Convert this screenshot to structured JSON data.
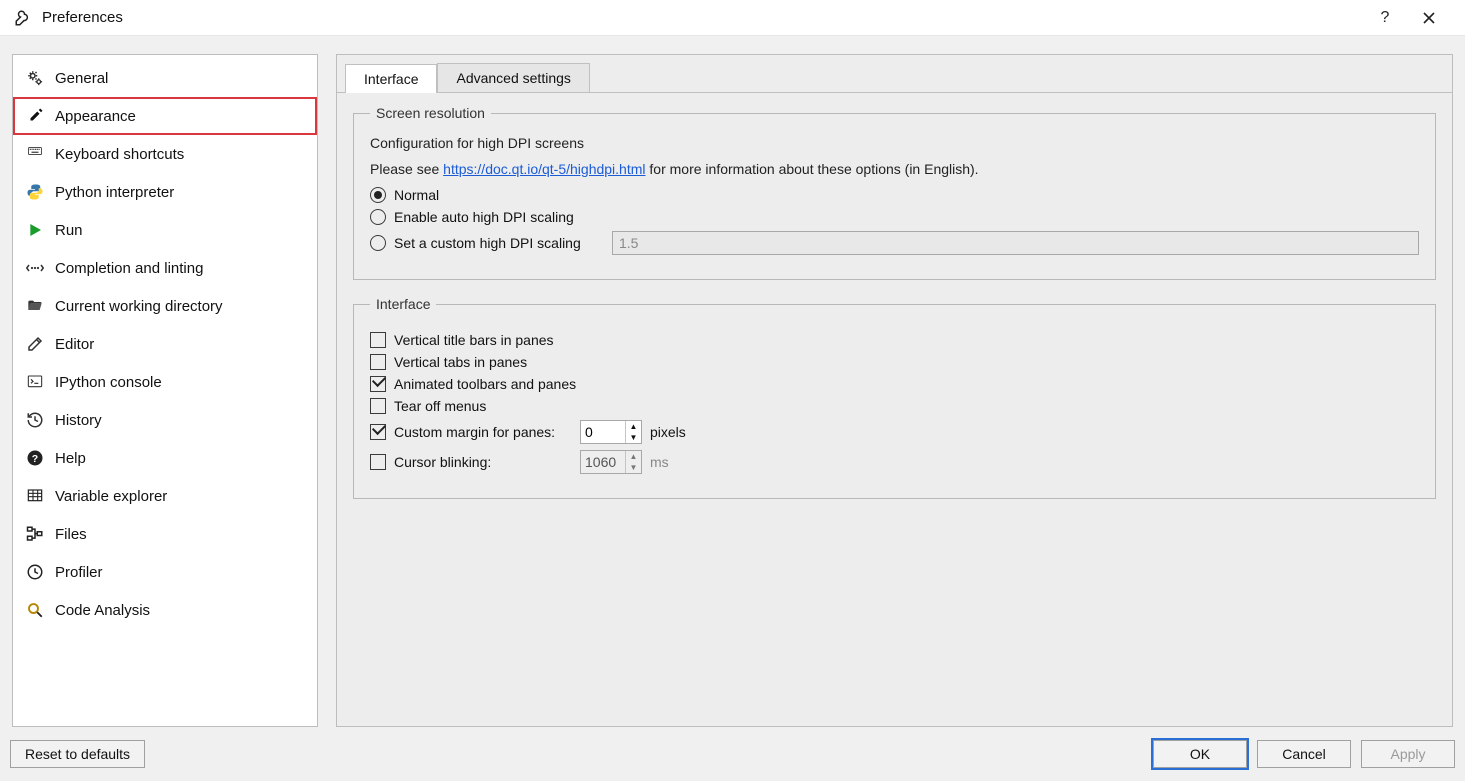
{
  "window": {
    "title": "Preferences"
  },
  "sidebar": {
    "items": [
      {
        "id": "general",
        "label": "General"
      },
      {
        "id": "appearance",
        "label": "Appearance",
        "highlighted": true
      },
      {
        "id": "keyboard-shortcuts",
        "label": "Keyboard shortcuts"
      },
      {
        "id": "python-interpreter",
        "label": "Python interpreter"
      },
      {
        "id": "run",
        "label": "Run"
      },
      {
        "id": "completion-linting",
        "label": "Completion and linting"
      },
      {
        "id": "cwd",
        "label": "Current working directory"
      },
      {
        "id": "editor",
        "label": "Editor"
      },
      {
        "id": "ipython-console",
        "label": "IPython console"
      },
      {
        "id": "history",
        "label": "History"
      },
      {
        "id": "help",
        "label": "Help"
      },
      {
        "id": "variable-explorer",
        "label": "Variable explorer"
      },
      {
        "id": "files",
        "label": "Files"
      },
      {
        "id": "profiler",
        "label": "Profiler"
      },
      {
        "id": "code-analysis",
        "label": "Code Analysis"
      }
    ]
  },
  "tabs": {
    "interface": "Interface",
    "advanced": "Advanced settings",
    "active": "interface"
  },
  "screen_res": {
    "legend": "Screen resolution",
    "subtitle": "Configuration for high DPI screens",
    "note_prefix": "Please see ",
    "note_link": "https://doc.qt.io/qt-5/highdpi.html",
    "note_suffix": " for more information about these options (in English).",
    "options": {
      "normal": "Normal",
      "auto": "Enable auto high DPI scaling",
      "custom": "Set a custom high DPI scaling"
    },
    "selected": "normal",
    "custom_value": "1.5"
  },
  "iface": {
    "legend": "Interface",
    "vtitle": {
      "label": "Vertical title bars in panes",
      "checked": false
    },
    "vtabs": {
      "label": "Vertical tabs in panes",
      "checked": false
    },
    "animated": {
      "label": "Animated toolbars and panes",
      "checked": true
    },
    "tearoff": {
      "label": "Tear off menus",
      "checked": false
    },
    "margin": {
      "label": "Custom margin for panes:",
      "checked": true,
      "value": "0",
      "unit": "pixels"
    },
    "blink": {
      "label": "Cursor blinking:",
      "checked": false,
      "value": "1060",
      "unit": "ms"
    }
  },
  "footer": {
    "reset": "Reset to defaults",
    "ok": "OK",
    "cancel": "Cancel",
    "apply": "Apply"
  }
}
